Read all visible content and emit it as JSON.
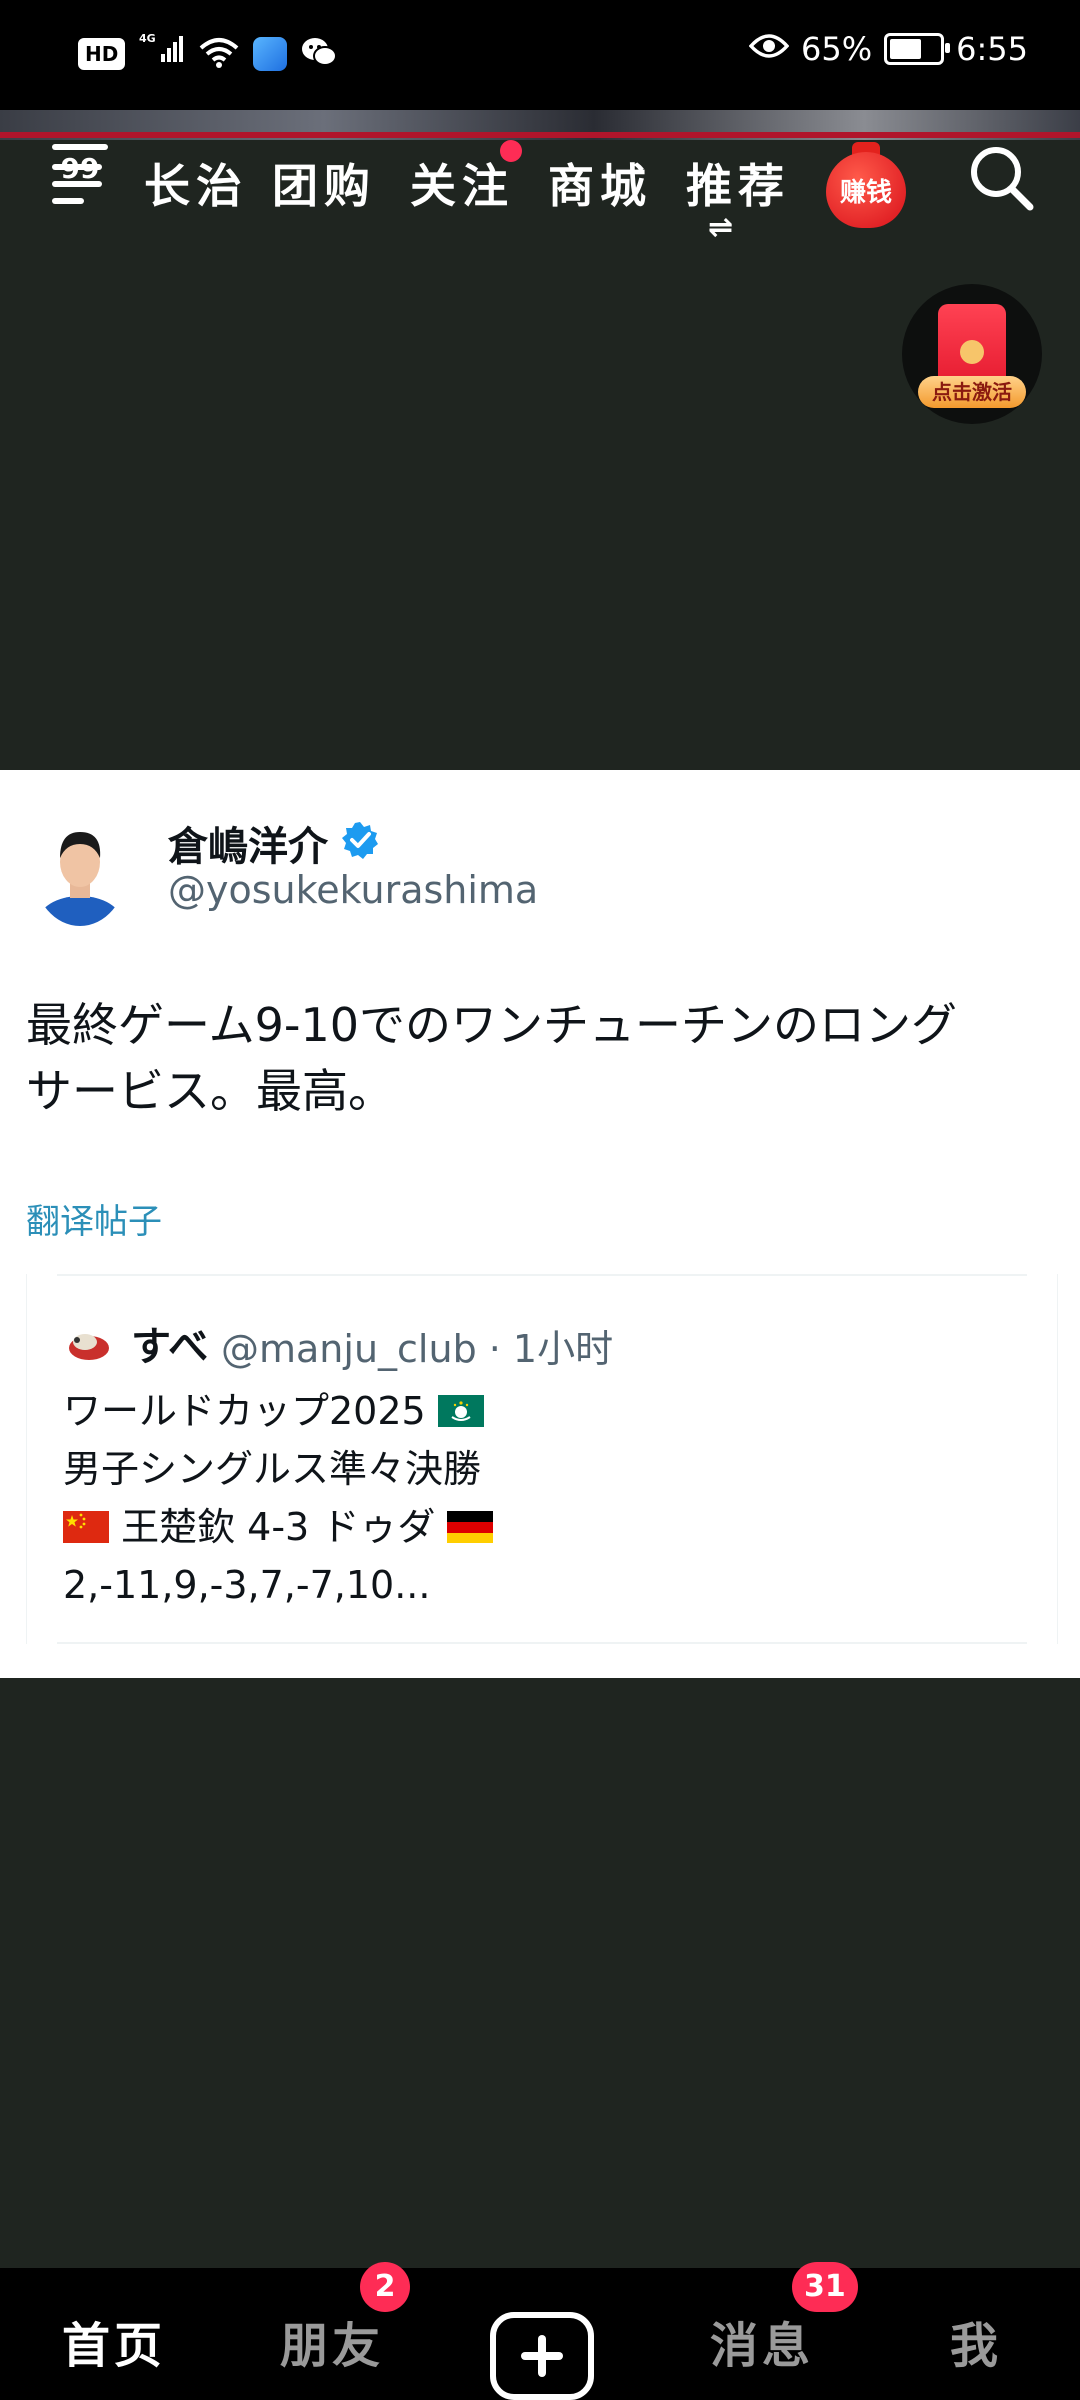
{
  "status_bar": {
    "hd": "HD",
    "network": "4G",
    "battery_percent": "65%",
    "battery_level": 0.65,
    "time": "6:55",
    "icons": [
      "hd-icon",
      "signal-icon",
      "wifi-icon",
      "browser-app-icon",
      "wechat-icon",
      "eye-icon",
      "battery-icon"
    ]
  },
  "top_nav": {
    "menu_badge": "99",
    "tabs": [
      "长治",
      "团购",
      "关注",
      "商城",
      "推荐"
    ],
    "active_tab": "推荐",
    "earn_label": "赚钱",
    "swap_icon": "⇌"
  },
  "floating_envelope": {
    "label": "点击激活"
  },
  "tweet": {
    "author_name": "倉嶋洋介",
    "author_handle": "@yosukekurashima",
    "text": "最終ゲーム9-10でのワンチューチンのロング\nサービス。最高。",
    "translate_link": "翻译帖子",
    "quote": {
      "name": "すべ",
      "handle_time": "@manju_club · 1小时",
      "line1": "ワールドカップ2025",
      "line2": "男子シングルス準々決勝",
      "line3": "王楚欽 4-3 ドゥダ",
      "line4": "2,-11,9,-3,7,-7,10..."
    }
  },
  "bottom_nav": {
    "items": [
      "首页",
      "朋友",
      "消息",
      "我"
    ],
    "friends_badge": "2",
    "messages_badge": "31"
  },
  "colors": {
    "background": "#1f2520",
    "accent_red": "#fe2c55",
    "link_blue": "#2b8fb8",
    "verified_blue": "#1d9bf0"
  }
}
